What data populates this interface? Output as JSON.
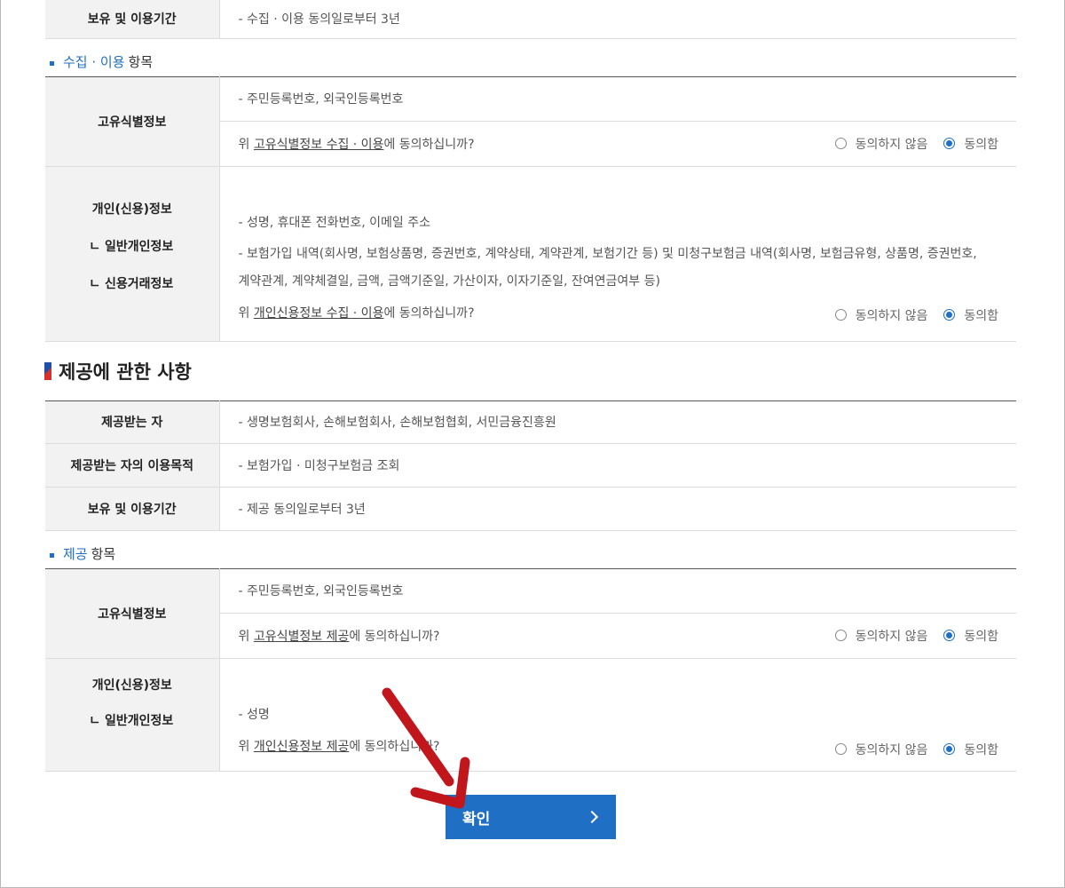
{
  "top": {
    "retention_label": "보유 및 이용기간",
    "retention_value": "- 수집 · 이용 동의일로부터 3년"
  },
  "collection_items": {
    "title_blue": "수집 · 이용",
    "title_rest": "항목",
    "unique": {
      "label": "고유식별정보",
      "value": "- 주민등록번호, 외국인등록번호",
      "q_prefix": "위 ",
      "q_link": "고유식별정보 수집 · 이용",
      "q_suffix": "에 동의하십니까?",
      "opt_no": "동의하지 않음",
      "opt_yes": "동의함"
    },
    "personal": {
      "label": "개인(신용)정보",
      "label_sub1": "ㄴ 일반개인정보",
      "label_sub2": "ㄴ 신용거래정보",
      "value1": "- 성명, 휴대폰 전화번호, 이메일 주소",
      "value2_line1": "- 보험가입 내역(회사명, 보험상품명, 증권번호, 계약상태, 계약관계, 보험기간 등) 및 미청구보험금 내역(회사명, 보험금유형, 상품명, 증권번호,",
      "value2_line2": "계약관계, 계약체결일, 금액, 금액기준일, 가산이자, 이자기준일, 잔여연금여부 등)",
      "q_prefix": "위 ",
      "q_link": "개인신용정보 수집 · 이용",
      "q_suffix": "에 동의하십니까?",
      "opt_no": "동의하지 않음",
      "opt_yes": "동의함"
    }
  },
  "provision": {
    "section_title": "제공에 관한 사항",
    "recipient_label": "제공받는 자",
    "recipient_value": "- 생명보험회사, 손해보험회사, 손해보험협회, 서민금융진흥원",
    "purpose_label": "제공받는 자의 이용목적",
    "purpose_value": "- 보험가입 · 미청구보험금 조회",
    "retention_label": "보유 및 이용기간",
    "retention_value": "- 제공 동의일로부터 3년"
  },
  "provision_items": {
    "title_blue": "제공",
    "title_rest": "항목",
    "unique": {
      "label": "고유식별정보",
      "value": "- 주민등록번호, 외국인등록번호",
      "q_prefix": "위 ",
      "q_link": "고유식별정보 제공",
      "q_suffix": "에 동의하십니까?",
      "opt_no": "동의하지 않음",
      "opt_yes": "동의함"
    },
    "personal": {
      "label": "개인(신용)정보",
      "label_sub1": "ㄴ 일반개인정보",
      "value1": "- 성명",
      "q_prefix": "위 ",
      "q_link": "개인신용정보 제공",
      "q_suffix": "에 동의하십니까?",
      "opt_no": "동의하지 않음",
      "opt_yes": "동의함"
    }
  },
  "confirm_label": "확인",
  "colors": {
    "accent": "#1f6fc5",
    "annotation_arrow": "#c0161c"
  },
  "icons": {
    "confirm": "chevron-right-icon",
    "annotation": "red-arrow-icon"
  }
}
